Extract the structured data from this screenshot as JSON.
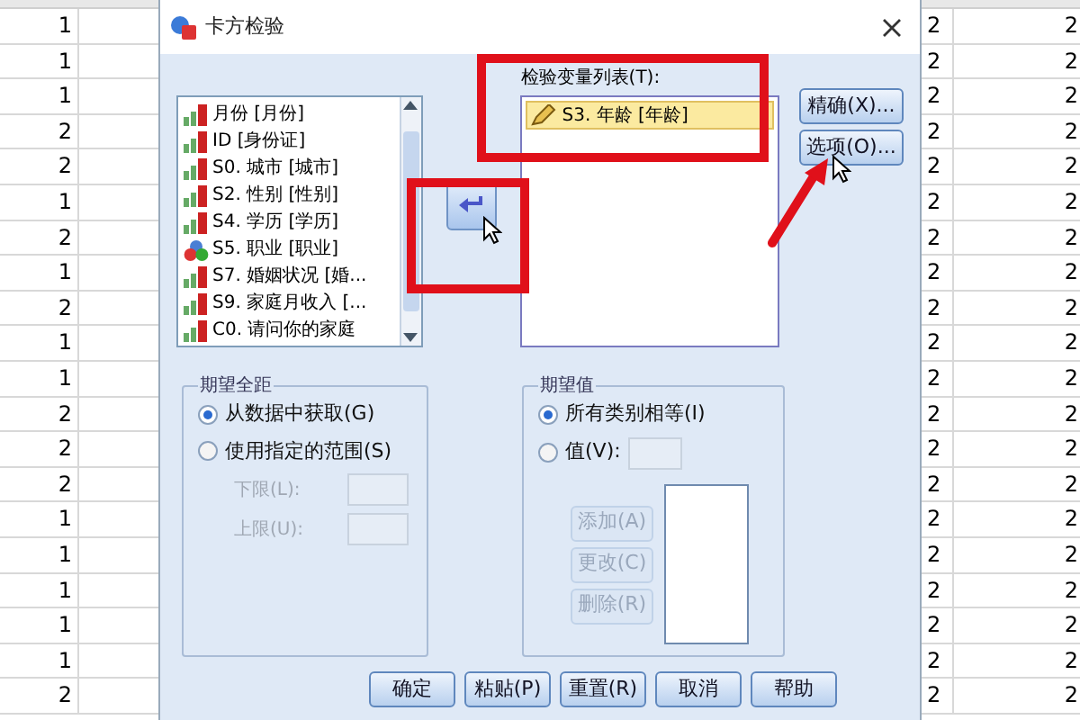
{
  "left_table": {
    "rows": [
      "1",
      "1",
      "1",
      "2",
      "2",
      "1",
      "2",
      "1",
      "2",
      "1",
      "1",
      "2",
      "2",
      "2",
      "1",
      "1",
      "1",
      "1",
      "1",
      "2"
    ]
  },
  "right_table": {
    "rows": [
      {
        "column_1": "2",
        "column_2": "2"
      },
      {
        "column_1": "2",
        "column_2": "2"
      },
      {
        "column_1": "2",
        "column_2": "2"
      },
      {
        "column_1": "2",
        "column_2": "2"
      },
      {
        "column_1": "2",
        "column_2": "2"
      },
      {
        "column_1": "2",
        "column_2": "2"
      },
      {
        "column_1": "2",
        "column_2": "2"
      },
      {
        "column_1": "2",
        "column_2": "2"
      },
      {
        "column_1": "2",
        "column_2": "2"
      },
      {
        "column_1": "2",
        "column_2": "2"
      },
      {
        "column_1": "2",
        "column_2": "2"
      },
      {
        "column_1": "2",
        "column_2": "2"
      },
      {
        "column_1": "2",
        "column_2": "2"
      },
      {
        "column_1": "2",
        "column_2": "2"
      },
      {
        "column_1": "2",
        "column_2": "2"
      },
      {
        "column_1": "2",
        "column_2": "2"
      },
      {
        "column_1": "2",
        "column_2": "2"
      },
      {
        "column_1": "2",
        "column_2": "2"
      },
      {
        "column_1": "2",
        "column_2": "2"
      },
      {
        "column_1": "2",
        "column_2": "2"
      }
    ]
  },
  "dialog": {
    "title": "卡方检验",
    "source_variables": [
      {
        "label": "月份 [月份]",
        "kind": "scale"
      },
      {
        "label": "ID [身份证]",
        "kind": "scale"
      },
      {
        "label": "S0. 城市 [城市]",
        "kind": "scale"
      },
      {
        "label": "S2. 性别 [性别]",
        "kind": "scale"
      },
      {
        "label": "S4. 学历 [学历]",
        "kind": "scale"
      },
      {
        "label": "S5. 职业 [职业]",
        "kind": "nominal"
      },
      {
        "label": "S7. 婚姻状况 [婚...",
        "kind": "scale"
      },
      {
        "label": "S9. 家庭月收入 [...",
        "kind": "scale"
      },
      {
        "label": "C0. 请问你的家庭",
        "kind": "scale"
      }
    ],
    "target_label": "检验变量列表(T):",
    "target_variables": [
      {
        "label": "S3. 年龄 [年龄]",
        "kind": "measure",
        "selected": true
      }
    ],
    "side_buttons": [
      "精确(X)...",
      "选项(O)..."
    ],
    "expected_range": {
      "title": "期望全距",
      "options": [
        {
          "label": "从数据中获取(G)",
          "selected": true
        },
        {
          "label": "使用指定的范围(S)",
          "selected": false
        }
      ],
      "fields": [
        {
          "label": "下限(L):",
          "disabled": true
        },
        {
          "label": "上限(U):",
          "disabled": true
        }
      ]
    },
    "expected_values": {
      "title": "期望值",
      "options": [
        {
          "label": "所有类别相等(I)",
          "selected": true
        },
        {
          "label": "值(V):",
          "selected": false
        }
      ],
      "buttons": [
        {
          "label": "添加(A)",
          "disabled": true
        },
        {
          "label": "更改(C)",
          "disabled": true
        },
        {
          "label": "删除(R)",
          "disabled": true
        }
      ]
    },
    "footer_buttons": [
      "确定",
      "粘贴(P)",
      "重置(R)",
      "取消",
      "帮助"
    ]
  }
}
